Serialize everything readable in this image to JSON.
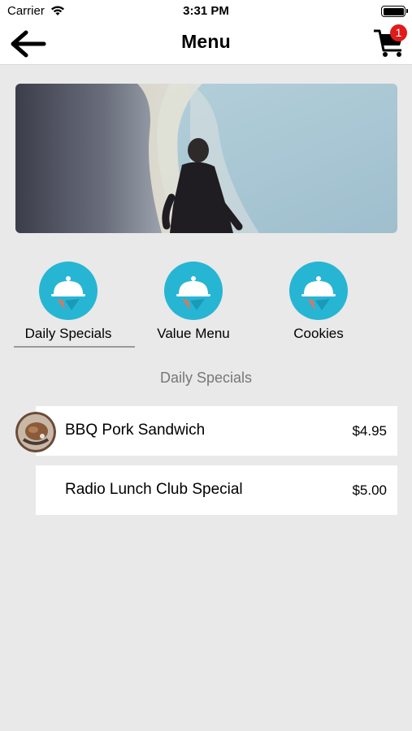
{
  "status_bar": {
    "carrier": "Carrier",
    "time": "3:31 PM",
    "battery_level": 1.0
  },
  "nav": {
    "title": "Menu",
    "back_icon": "arrow-left-icon",
    "cart_icon": "shopping-cart-icon",
    "cart_count": "1"
  },
  "banner": {
    "description_icon": "surfer-photo"
  },
  "categories": [
    {
      "label": "Daily Specials",
      "icon": "cloche-icon",
      "selected": true
    },
    {
      "label": "Value Menu",
      "icon": "cloche-icon",
      "selected": false
    },
    {
      "label": "Cookies",
      "icon": "cloche-icon",
      "selected": false
    }
  ],
  "section": {
    "title": "Daily Specials"
  },
  "items": [
    {
      "name": "BBQ Pork Sandwich",
      "price": "$4.95",
      "has_thumbnail": true
    },
    {
      "name": "Radio Lunch Club Special",
      "price": "$5.00",
      "has_thumbnail": false
    }
  ],
  "colors": {
    "accent": "#27b5d4",
    "badge": "#e01b1b",
    "background": "#e9e9e9"
  }
}
